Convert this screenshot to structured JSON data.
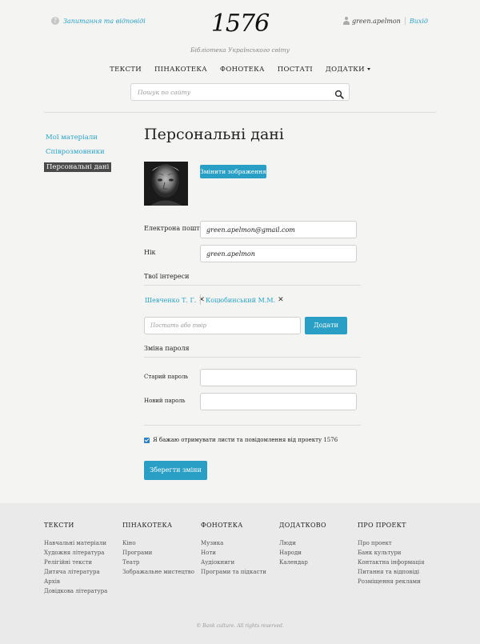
{
  "header": {
    "faq_icon": "question-icon",
    "faq_label": "Запитання та відповіді",
    "logo": "1576",
    "tagline": "Бібліотека Українського світу",
    "username": "green.apelmon",
    "logout": "Вихід"
  },
  "nav": {
    "items": [
      "ТЕКСТИ",
      "ПІНАКОТЕКА",
      "ФОНОТЕКА",
      "ПОСТАТІ",
      "ДОДАТКИ"
    ]
  },
  "search": {
    "placeholder": "Пошук по сайту",
    "icon": "search-icon"
  },
  "sidebar": {
    "items": [
      {
        "label": "Мої матеріали",
        "active": false
      },
      {
        "label": "Співрозмовники",
        "active": false
      },
      {
        "label": "Персональні дані",
        "active": true
      }
    ]
  },
  "main": {
    "title": "Персональні дані",
    "change_image": "Змінити зображення",
    "email_label": "Електрона пошта",
    "email_value": "green.apelmon@gmail.com",
    "nick_label": "Нік",
    "nick_value": "green.apelmon",
    "interests_head": "Твої інтереси",
    "interests": [
      "Шевченко Т. Г.",
      "Коцюбинський М.М."
    ],
    "interest_placeholder": "Постать або твір",
    "add_label": "Додати",
    "password_head": "Зміна пароля",
    "old_password_label": "Старий пароль",
    "new_password_label": "Новий пароль",
    "subscribe_label": "Я бажаю отримувати листи та повідомлення від проекту 1576",
    "save_label": "Зберегти зміни"
  },
  "footer": {
    "columns": [
      {
        "title": "ТЕКСТИ",
        "links": [
          "Навчальні матеріали",
          "Художня література",
          "Релігійні тексти",
          "Дитяча література",
          "Архів",
          "Довідкова література"
        ]
      },
      {
        "title": "ПІНАКОТЕКА",
        "links": [
          "Кіно",
          "Програми",
          "Театр",
          "Зображальне мистецтво"
        ]
      },
      {
        "title": "ФОНОТЕКА",
        "links": [
          "Музика",
          "Ноти",
          "Аудіокниги",
          "Програми та підкасти"
        ]
      },
      {
        "title": "ДОДАТКОВО",
        "links": [
          "Люди",
          "Народи",
          "Календар"
        ]
      },
      {
        "title": "ПРО ПРОЕКТ",
        "links": [
          "Про проект",
          "Банк культури",
          "Контактна інформація",
          "Питання та відповіді",
          "Розміщення реклами"
        ]
      }
    ],
    "copyright": "© Bank culture. All rights reserved."
  },
  "colors": {
    "accent": "#2a9fc6",
    "link": "#2aa3c9",
    "background": "#f4f4f3",
    "footer_bg": "#eaeaea"
  }
}
